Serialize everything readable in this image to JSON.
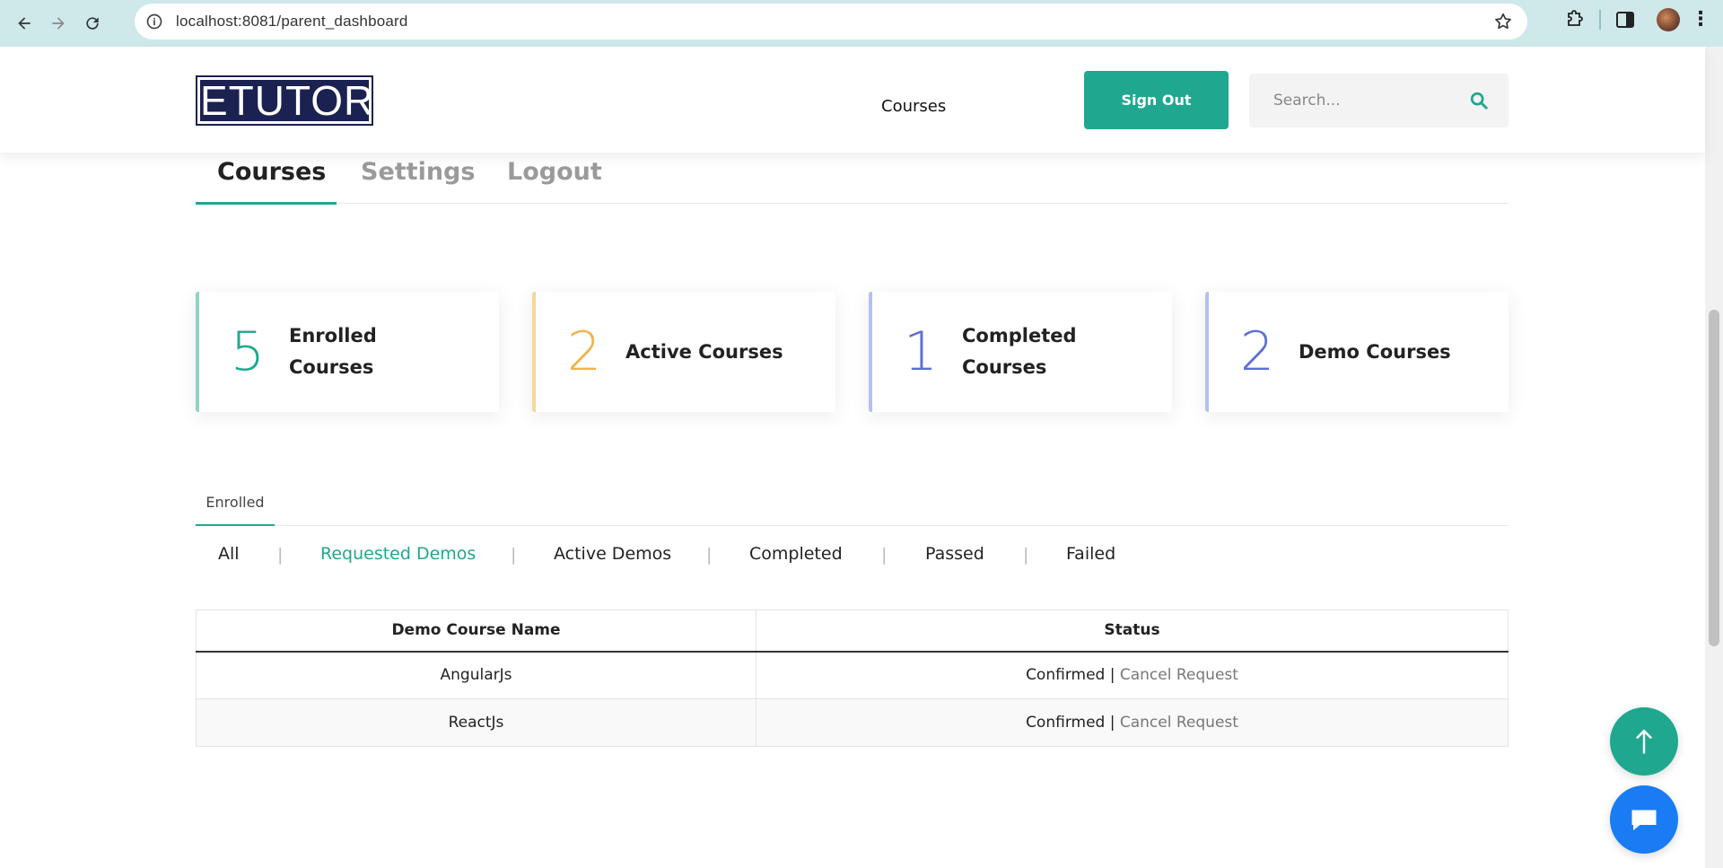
{
  "browser": {
    "url": "localhost:8081/parent_dashboard"
  },
  "header": {
    "logo_text": "ETUTOR",
    "nav_courses": "Courses",
    "sign_out_label": "Sign Out",
    "search_placeholder": "Search..."
  },
  "main_tabs": [
    {
      "label": "Courses",
      "active": true
    },
    {
      "label": "Settings",
      "active": false
    },
    {
      "label": "Logout",
      "active": false
    }
  ],
  "stats": [
    {
      "value": "5",
      "label": "Enrolled Courses",
      "color": "#1fa88f"
    },
    {
      "value": "2",
      "label": "Active Courses",
      "color": "#f0b44c"
    },
    {
      "value": "1",
      "label": "Completed Courses",
      "color": "#5b6fd6"
    },
    {
      "value": "2",
      "label": "Demo Courses",
      "color": "#5b6fd6"
    }
  ],
  "enrolled_tab": "Enrolled",
  "filter_tabs": [
    {
      "label": "All",
      "active": false
    },
    {
      "label": "Requested Demos",
      "active": true
    },
    {
      "label": "Active Demos",
      "active": false
    },
    {
      "label": "Completed",
      "active": false
    },
    {
      "label": "Passed",
      "active": false
    },
    {
      "label": "Failed",
      "active": false
    }
  ],
  "filter_separator": "|",
  "table": {
    "columns": [
      "Demo Course Name",
      "Status"
    ],
    "rows": [
      {
        "course": "AngularJs",
        "status": "Confirmed",
        "separator": "|",
        "action": "Cancel Request"
      },
      {
        "course": "ReactJs",
        "status": "Confirmed",
        "separator": "|",
        "action": "Cancel Request"
      }
    ]
  },
  "icons": {
    "back": "arrow-left-icon",
    "forward": "arrow-right-icon",
    "reload": "reload-icon",
    "site_info": "info-icon",
    "bookmark": "star-icon",
    "extensions": "puzzle-icon",
    "side_panel": "side-panel-icon",
    "menu": "kebab-menu-icon",
    "search": "search-icon",
    "scroll_top": "arrow-up-icon",
    "chat": "chat-icon"
  },
  "colors": {
    "accent": "#1fa88f",
    "chrome_bar": "#cfe8ea",
    "chat_button": "#1a7cf5",
    "logo_bg": "#1b2150"
  }
}
